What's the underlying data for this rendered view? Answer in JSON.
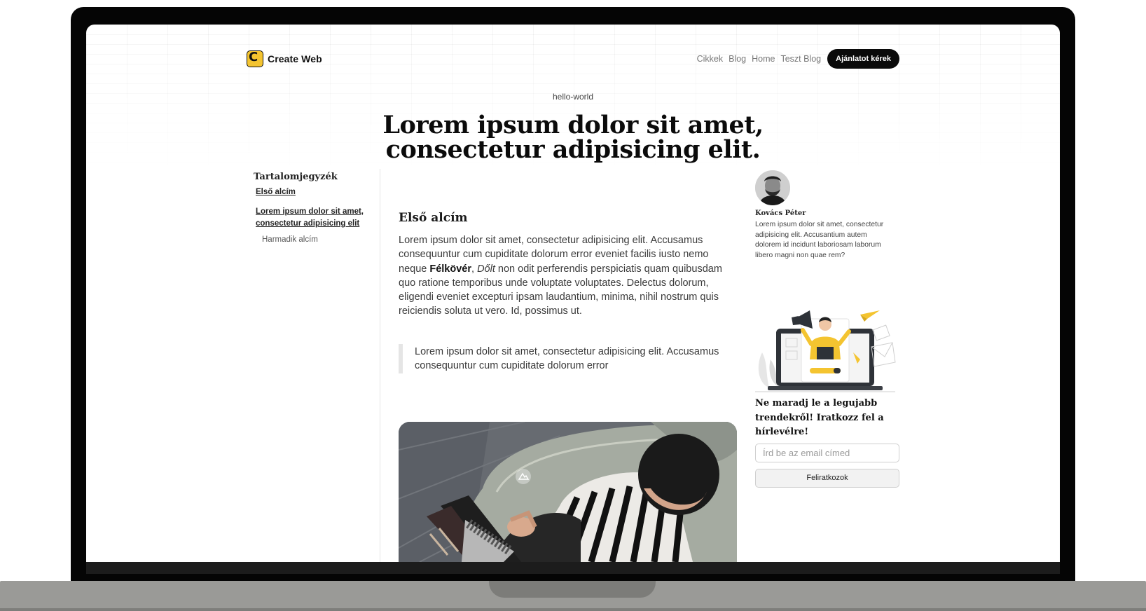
{
  "header": {
    "logo_text": "Create Web",
    "nav": [
      "Cikkek",
      "Blog",
      "Home",
      "Teszt Blog"
    ],
    "cta_label": "Ajánlatot kérek"
  },
  "post": {
    "slug": "hello-world",
    "title_line1": "Lorem ipsum dolor sit amet,",
    "title_line2": "consectetur adipisicing elit."
  },
  "toc": {
    "title": "Tartalomjegyzék",
    "items": [
      "Első alcím",
      "Lorem ipsum dolor sit amet, consectetur adipisicing elit",
      "Harmadik alcím"
    ]
  },
  "article": {
    "heading": "Első alcím",
    "para_start": "Lorem ipsum dolor sit amet, consectetur adipisicing elit. Accusamus consequuntur cum cupiditate dolorum error eveniet facilis iusto nemo neque ",
    "bold_word": "Félkövér",
    "separator": ", ",
    "italic_word": "Dőlt",
    "para_end": " non odit perferendis perspiciatis quam quibusdam quo ratione temporibus unde voluptate voluptates. Delectus dolorum, eligendi eveniet excepturi ipsam laudantium, minima, nihil nostrum quis reiciendis soluta ut vero. Id, possimus ut.",
    "quote": "Lorem ipsum dolor sit amet, consectetur adipisicing elit. Accusamus consequuntur cum cupiditate dolorum error"
  },
  "author": {
    "name": "Kovács Péter",
    "bio": "Lorem ipsum dolor sit amet, consectetur adipisicing elit. Accusantium autem dolorem id incidunt laboriosam laborum libero magni non quae rem?"
  },
  "newsletter": {
    "title": "Ne maradj le a legujabb trendekről! Iratkozz fel a hírlevélre!",
    "email_placeholder": "Írd be az email címed",
    "button_label": "Feliratkozok"
  },
  "colors": {
    "accent": "#f4c430",
    "cta_bg": "#0a0a0a"
  }
}
